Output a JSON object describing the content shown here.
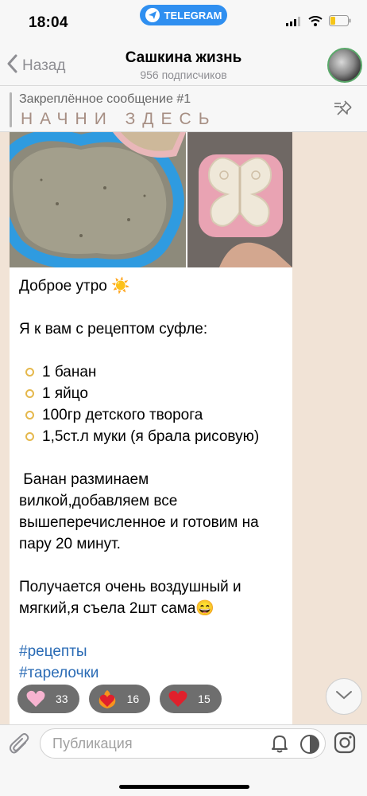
{
  "status": {
    "time": "18:04",
    "app_pill": "TELEGRAM"
  },
  "header": {
    "back_label": "Назад",
    "title": "Сашкина жизнь",
    "subtitle": "956 подписчиков"
  },
  "pinned": {
    "title": "Закреплённое сообщение #1",
    "text": "НАЧНИ ЗДЕСЬ"
  },
  "message": {
    "greeting": "Доброе утро ☀️",
    "intro": "Я к вам с рецептом суфле:",
    "ingredients": [
      "1 банан",
      "1 яйцо",
      "100гр детского творога",
      "1,5ст.л муки (я брала рисовую)"
    ],
    "steps": [
      " Банан разминаем",
      "вилкой,добавляем все",
      "вышеперечисленное и готовим на",
      "пару 20 минут."
    ],
    "result": [
      "Получается очень воздушный и",
      "мягкий,я съела 2шт сама😄"
    ],
    "hashtags": [
      "#рецепты",
      "#тарелочки"
    ],
    "reactions": [
      {
        "emoji": "🩷",
        "count": "33"
      },
      {
        "emoji": "❤️‍🔥",
        "count": "16"
      },
      {
        "emoji": "❤️",
        "count": "15"
      }
    ]
  },
  "input": {
    "placeholder": "Публикация"
  },
  "colors": {
    "chat_bg": "#f1e3d6",
    "accent": "#2f8ff0",
    "hashtag": "#2a6bb5",
    "pinned_text": "#a68e83"
  }
}
